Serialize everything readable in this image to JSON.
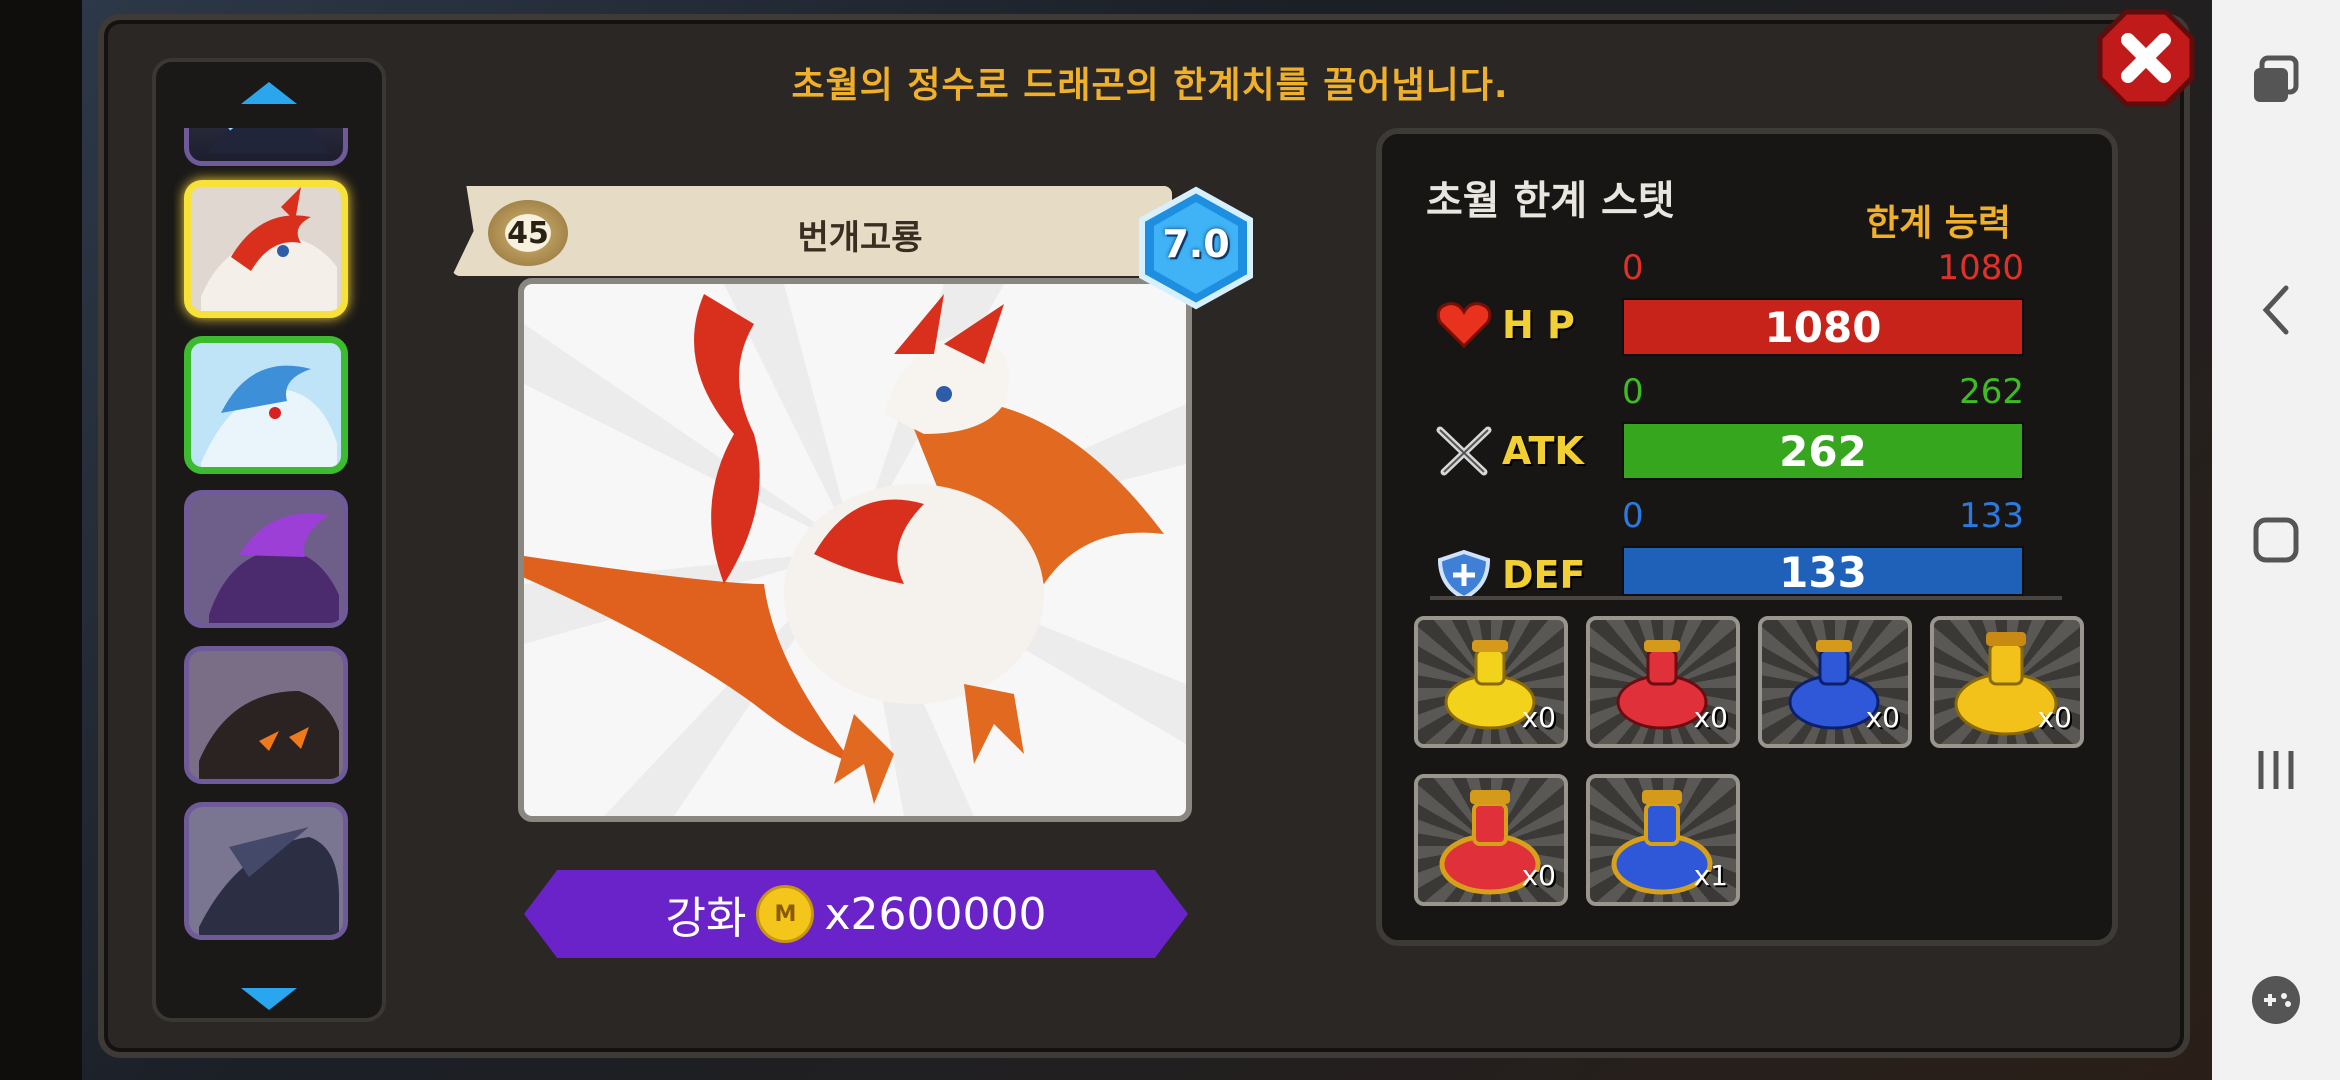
{
  "headline": "초월의 정수로 드래곤의 한계치를 끌어냅니다.",
  "dragon": {
    "level": "45",
    "name": "번개고룡",
    "grade": "7.0"
  },
  "enhance": {
    "label": "강화",
    "coin_symbol": "M",
    "cost": "x2600000"
  },
  "stats": {
    "title": "초월 한계 스탯",
    "ability_label": "한계 능력",
    "hp": {
      "label": "H P",
      "min": "0",
      "max": "1080",
      "value": "1080",
      "color": "#c8231b"
    },
    "atk": {
      "label": "ATK",
      "min": "0",
      "max": "262",
      "value": "262",
      "color": "#36a61e"
    },
    "def": {
      "label": "DEF",
      "min": "0",
      "max": "133",
      "value": "133",
      "color": "#1f60b8"
    }
  },
  "potions": [
    {
      "name": "yellow-potion",
      "count": "x0",
      "color": "#f2d21a"
    },
    {
      "name": "red-potion",
      "count": "x0",
      "color": "#e0303a"
    },
    {
      "name": "blue-potion",
      "count": "x0",
      "color": "#2f58d8"
    },
    {
      "name": "gold-potion",
      "count": "x0",
      "color": "#f2c21a"
    },
    {
      "name": "red-elixir",
      "count": "x0",
      "color": "#e0303a"
    },
    {
      "name": "blue-elixir",
      "count": "x1",
      "color": "#2f58d8"
    }
  ],
  "dragon_list": [
    "dark-dragon",
    "lightning-dragon",
    "ice-dragon",
    "purple-dragon",
    "black-fire-dragon",
    "steel-dragon"
  ]
}
